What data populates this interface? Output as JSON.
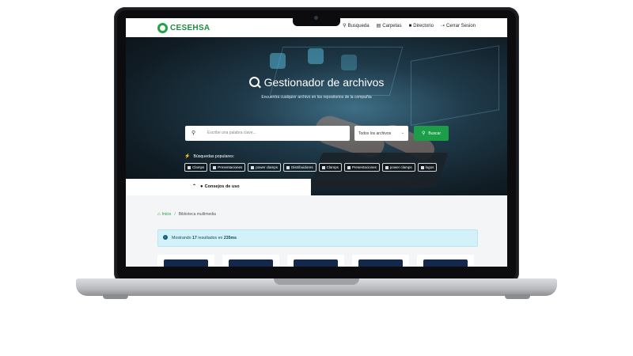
{
  "nav": {
    "logo_text": "CESEHSA",
    "items": [
      {
        "label": "Busqueda",
        "icon": "search-icon"
      },
      {
        "label": "Carpetas",
        "icon": "folder-icon"
      },
      {
        "label": "Directorio",
        "icon": "address-book-icon"
      },
      {
        "label": "Cerrar Sesion",
        "icon": "logout-icon"
      }
    ]
  },
  "hero": {
    "title": "Gestionador de archivos",
    "subtitle": "Encuentra cualquier archivo en los repositorios de la compañia"
  },
  "search": {
    "placeholder": "Escribe una palabra clave...",
    "filter_value": "Todos los archivos",
    "button_label": "Buscar"
  },
  "popular": {
    "label": "Búsquedas populares:",
    "chips": [
      "Clamps",
      "Presentaciones",
      "power clamps",
      "Distribuidores",
      "Clamps",
      "Presentaciones",
      "power clamps",
      "logos"
    ]
  },
  "tips": {
    "label": "Consejos de uso"
  },
  "breadcrumb": {
    "home": "Inicio",
    "current": "Biblioteca multimedia"
  },
  "results": {
    "prefix": "Mostrando",
    "count": "17",
    "middle": "resultados en",
    "time": "235ms"
  },
  "colors": {
    "brand_green": "#1c9e48",
    "alert_bg": "#d3f1f9",
    "card_accent": "#13284b"
  }
}
